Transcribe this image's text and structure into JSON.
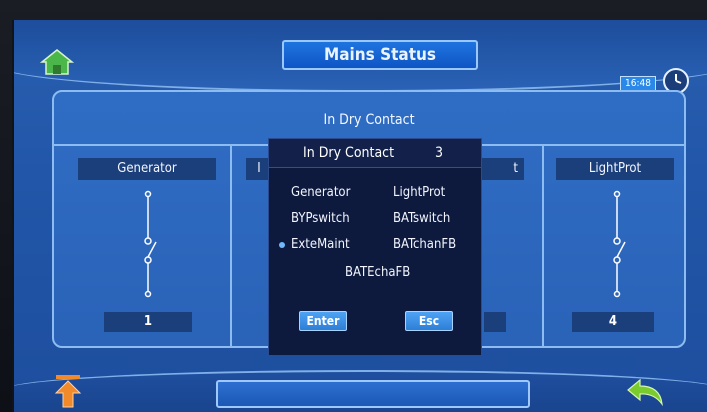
{
  "header": {
    "title": "Mains Status",
    "time": "16:48",
    "icons": {
      "home": "home-icon",
      "clock": "clock-icon"
    }
  },
  "panel": {
    "title": "In Dry Contact",
    "columns": [
      {
        "label": "Generator",
        "number": "1"
      },
      {
        "label": "I",
        "number": ""
      },
      {
        "label": "t",
        "number": ""
      },
      {
        "label": "LightProt",
        "number": "4"
      }
    ]
  },
  "dialog": {
    "title": "In Dry Contact",
    "count": "3",
    "options": [
      {
        "label": "Generator",
        "selected": false
      },
      {
        "label": "LightProt",
        "selected": false
      },
      {
        "label": "BYPswitch",
        "selected": false
      },
      {
        "label": "BATswitch",
        "selected": false
      },
      {
        "label": "ExteMaint",
        "selected": true
      },
      {
        "label": "BATchanFB",
        "selected": false
      },
      {
        "label": "BATEchaFB",
        "selected": false
      }
    ],
    "enter_label": "Enter",
    "esc_label": "Esc"
  },
  "footer": {
    "icons": {
      "up": "up-arrow-icon",
      "back": "back-arrow-icon"
    },
    "status_text": ""
  },
  "colors": {
    "screen_blue": "#2a5fb0",
    "accent_light": "#8cbcf0",
    "dialog_bg": "#0e1a3d",
    "home_green": "#4bb74b",
    "up_orange": "#f08a2a",
    "back_green": "#7acb2e"
  }
}
